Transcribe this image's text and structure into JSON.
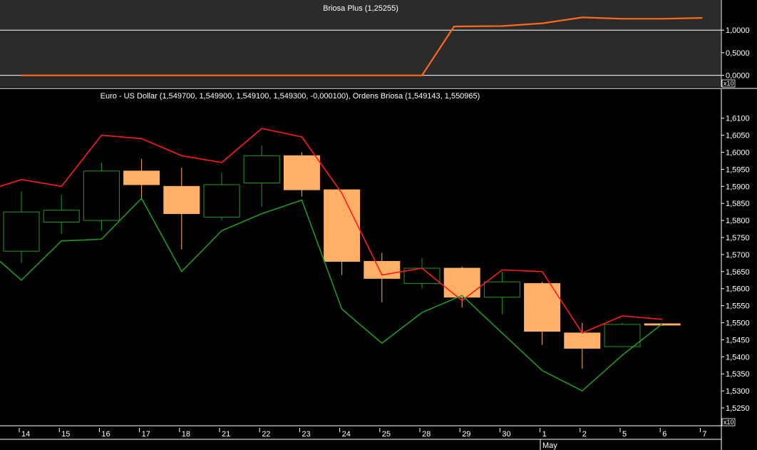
{
  "chart_data": [
    {
      "type": "line",
      "title": "Briosa Plus (1,25255)",
      "ylim": [
        -0.1,
        1.35
      ],
      "yticks": [
        "1,0000",
        "0,5000",
        "0,0000"
      ],
      "ytick_values": [
        1.0,
        0.5,
        0.0
      ],
      "scale_badge": "x10",
      "series": [
        {
          "color": "#ff6a1a",
          "x": [
            0,
            0.2,
            1,
            2,
            3,
            4,
            5,
            6,
            7,
            8,
            9,
            10,
            10.8,
            12,
            13,
            14,
            15,
            16,
            17
          ],
          "y": [
            0.0,
            0.0,
            0.0,
            0.0,
            0.0,
            0.0,
            0.0,
            0.0,
            0.0,
            0.0,
            0.0,
            0.0,
            1.08,
            1.09,
            1.15,
            1.28,
            1.25,
            1.25,
            1.27
          ]
        }
      ]
    },
    {
      "type": "candlestick",
      "title": "Euro - US Dollar (1,549700, 1,549900, 1,549100, 1,549300, -0,000100), Ordens Briosa (1,549143, 1,550965)",
      "ylim": [
        1.5225,
        1.6135
      ],
      "yticks": [
        "1,6100",
        "1,6050",
        "1,6000",
        "1,5950",
        "1,5900",
        "1,5850",
        "1,5800",
        "1,5750",
        "1,5700",
        "1,5650",
        "1,5600",
        "1,5550",
        "1,5500",
        "1,5450",
        "1,5400",
        "1,5350",
        "1,5300",
        "1,5250"
      ],
      "ytick_values": [
        1.61,
        1.605,
        1.6,
        1.595,
        1.59,
        1.585,
        1.58,
        1.575,
        1.57,
        1.565,
        1.56,
        1.555,
        1.55,
        1.545,
        1.54,
        1.535,
        1.53,
        1.525
      ],
      "scale_badge": "x10",
      "categories": [
        "14",
        "15",
        "16",
        "17",
        "18",
        "21",
        "22",
        "23",
        "24",
        "25",
        "28",
        "29",
        "30",
        "1",
        "2",
        "5",
        "6",
        "7"
      ],
      "month_label": "May",
      "candles": [
        {
          "open": 1.571,
          "high": 1.5885,
          "low": 1.5675,
          "close": 1.5825
        },
        {
          "open": 1.5795,
          "high": 1.5875,
          "low": 1.576,
          "close": 1.583
        },
        {
          "open": 1.58,
          "high": 1.597,
          "low": 1.577,
          "close": 1.5945
        },
        {
          "open": 1.5945,
          "high": 1.598,
          "low": 1.586,
          "close": 1.5905
        },
        {
          "open": 1.59,
          "high": 1.5955,
          "low": 1.5715,
          "close": 1.582
        },
        {
          "open": 1.581,
          "high": 1.594,
          "low": 1.58,
          "close": 1.5905
        },
        {
          "open": 1.591,
          "high": 1.602,
          "low": 1.584,
          "close": 1.599
        },
        {
          "open": 1.599,
          "high": 1.6,
          "low": 1.587,
          "close": 1.589
        },
        {
          "open": 1.589,
          "high": 1.589,
          "low": 1.564,
          "close": 1.568
        },
        {
          "open": 1.568,
          "high": 1.5705,
          "low": 1.556,
          "close": 1.563
        },
        {
          "open": 1.5615,
          "high": 1.569,
          "low": 1.56,
          "close": 1.566
        },
        {
          "open": 1.566,
          "high": 1.5665,
          "low": 1.5545,
          "close": 1.5575
        },
        {
          "open": 1.5575,
          "high": 1.565,
          "low": 1.5525,
          "close": 1.562
        },
        {
          "open": 1.5615,
          "high": 1.562,
          "low": 1.5435,
          "close": 1.5475
        },
        {
          "open": 1.547,
          "high": 1.55,
          "low": 1.5365,
          "close": 1.5425
        },
        {
          "open": 1.543,
          "high": 1.55,
          "low": 1.543,
          "close": 1.5495
        },
        {
          "open": 1.5497,
          "high": 1.5499,
          "low": 1.5491,
          "close": 1.5493
        }
      ],
      "series": [
        {
          "color": "#ff1a1a",
          "x": [
            -0.6,
            0,
            1,
            2,
            3,
            4,
            5,
            6,
            7,
            8,
            9,
            10,
            11,
            12,
            13,
            14,
            15,
            16
          ],
          "y": [
            1.59,
            1.592,
            1.59,
            1.605,
            1.604,
            1.599,
            1.597,
            1.607,
            1.6045,
            1.588,
            1.564,
            1.566,
            1.5565,
            1.5655,
            1.565,
            1.547,
            1.552,
            1.551
          ]
        },
        {
          "color": "#1e9a1e",
          "x": [
            -0.6,
            0,
            1,
            2,
            3,
            4,
            5,
            6,
            7,
            8,
            9,
            10,
            11,
            12,
            13,
            14,
            15,
            16
          ],
          "y": [
            1.568,
            1.5625,
            1.574,
            1.5745,
            1.5865,
            1.565,
            1.577,
            1.582,
            1.586,
            1.554,
            1.544,
            1.553,
            1.558,
            1.547,
            1.536,
            1.53,
            1.5405,
            1.5497
          ]
        }
      ]
    }
  ]
}
